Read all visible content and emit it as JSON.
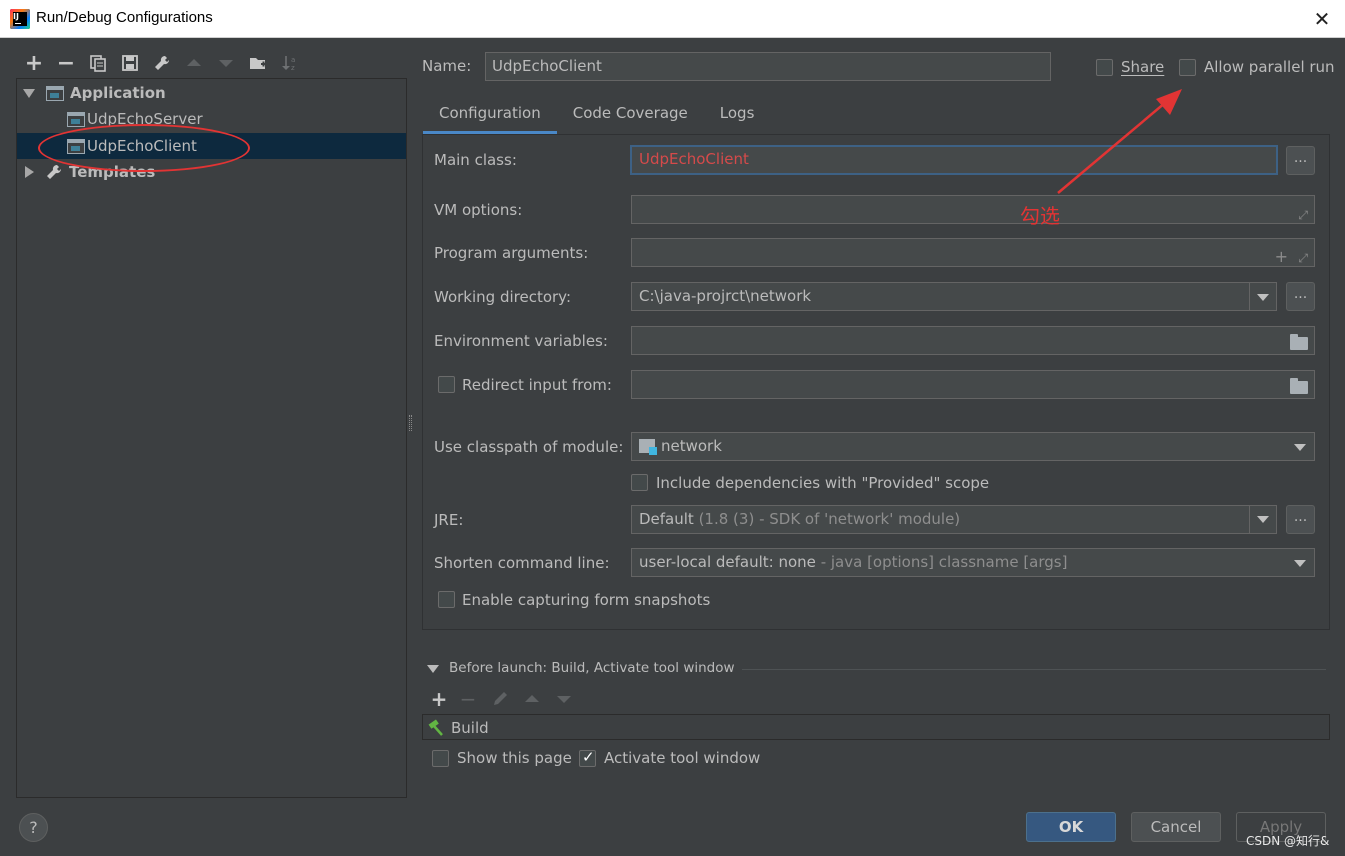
{
  "window": {
    "title": "Run/Debug Configurations",
    "close_symbol": "✕"
  },
  "left_toolbar": {
    "add_symbol": "+",
    "remove_symbol": "−",
    "icons": [
      "add-icon",
      "remove-icon",
      "copy-icon",
      "save-icon",
      "wrench-icon",
      "move-up-icon",
      "move-down-icon",
      "new-folder-icon",
      "sort-icon"
    ]
  },
  "tree": {
    "application_label": "Application",
    "items": [
      {
        "label": "UdpEchoServer"
      },
      {
        "label": "UdpEchoClient"
      }
    ],
    "templates_label": "Templates"
  },
  "header": {
    "name_label": "Name:",
    "name_value": "UdpEchoClient",
    "share_label": "Share",
    "share_checked": false,
    "allow_parallel_label": "Allow parallel run",
    "allow_parallel_checked": false
  },
  "tabs": [
    {
      "label": "Configuration",
      "active": true
    },
    {
      "label": "Code Coverage",
      "active": false
    },
    {
      "label": "Logs",
      "active": false
    }
  ],
  "form": {
    "main_class_label": "Main class:",
    "main_class_value": "UdpEchoClient",
    "vm_options_label": "VM options:",
    "vm_options_value": "",
    "program_args_label": "Program arguments:",
    "program_args_value": "",
    "working_dir_label": "Working directory:",
    "working_dir_value": "C:\\java-projrct\\network",
    "env_vars_label": "Environment variables:",
    "env_vars_value": "",
    "redirect_label": "Redirect input from:",
    "redirect_checked": false,
    "classpath_label": "Use classpath of module:",
    "classpath_value": "network",
    "include_deps_label": "Include dependencies with \"Provided\" scope",
    "include_deps_checked": false,
    "jre_label": "JRE:",
    "jre_value": "Default",
    "jre_detail": " (1.8 (3) - SDK of 'network' module)",
    "shorten_label": "Shorten command line:",
    "shorten_value": "user-local default: none",
    "shorten_detail": " - java [options] classname [args]",
    "snapshots_label": "Enable capturing form snapshots",
    "snapshots_checked": false,
    "browse_label": "..."
  },
  "annotation": {
    "text": "勾选",
    "color": "#e23434"
  },
  "before_launch": {
    "title": "Before launch: Build, Activate tool window",
    "add_symbol": "+",
    "remove_symbol": "−",
    "items": [
      {
        "label": "Build"
      }
    ],
    "show_page_label": "Show this page",
    "show_page_checked": false,
    "activate_label": "Activate tool window",
    "activate_checked": true
  },
  "footer": {
    "help_label": "?",
    "ok_label": "OK",
    "cancel_label": "Cancel",
    "apply_label": "Apply",
    "watermark": "CSDN @知行&"
  },
  "colors": {
    "background": "#3c3f41",
    "selection": "#0d293e",
    "accent": "#4a88c7",
    "annotation": "#e23434"
  }
}
